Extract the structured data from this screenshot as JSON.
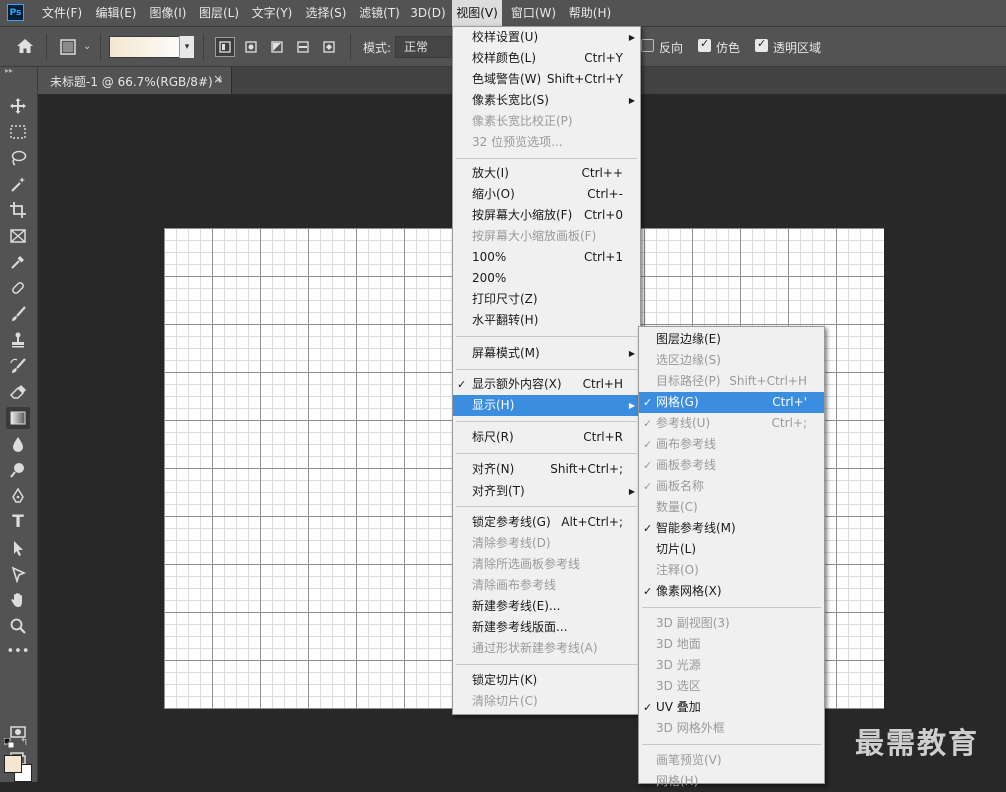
{
  "app": {
    "logo_text": "Ps"
  },
  "menubar": {
    "items": [
      {
        "label": "文件(F)"
      },
      {
        "label": "编辑(E)"
      },
      {
        "label": "图像(I)"
      },
      {
        "label": "图层(L)"
      },
      {
        "label": "文字(Y)"
      },
      {
        "label": "选择(S)"
      },
      {
        "label": "滤镜(T)"
      },
      {
        "label": "3D(D)"
      },
      {
        "label": "视图(V)"
      },
      {
        "label": "窗口(W)"
      },
      {
        "label": "帮助(H)"
      }
    ],
    "active_item": "视图(V)"
  },
  "options_bar": {
    "mode_label": "模式:",
    "mode_value": "正常",
    "checkboxes": [
      {
        "label": "反向",
        "checked": false
      },
      {
        "label": "仿色",
        "checked": true
      },
      {
        "label": "透明区域",
        "checked": true
      }
    ],
    "gradient_colors": [
      "#f3e7d1",
      "#ffffff"
    ]
  },
  "document_tab": {
    "title": "未标题-1 @ 66.7%(RGB/8#) *",
    "close": "×"
  },
  "toolbar": {
    "tools": [
      "move-tool",
      "marquee-tool",
      "lasso-tool",
      "magic-wand-tool",
      "crop-tool",
      "frame-tool",
      "eyedropper-tool",
      "healing-brush-tool",
      "brush-tool",
      "clone-stamp-tool",
      "history-brush-tool",
      "eraser-tool",
      "gradient-tool",
      "blur-tool",
      "dodge-tool",
      "pen-tool",
      "type-tool",
      "path-selection-tool",
      "shape-tool",
      "hand-tool",
      "zoom-tool",
      "more-tools"
    ],
    "selected_tool": "gradient-tool",
    "foreground_color": "#f3e7d1",
    "background_color": "#ffffff"
  },
  "view_menu": {
    "items": [
      {
        "label": "校样设置(U)",
        "shortcut": "",
        "submenu": true,
        "disabled": false
      },
      {
        "label": "校样颜色(L)",
        "shortcut": "Ctrl+Y",
        "disabled": false
      },
      {
        "label": "色域警告(W)",
        "shortcut": "Shift+Ctrl+Y",
        "disabled": false
      },
      {
        "label": "像素长宽比(S)",
        "shortcut": "",
        "submenu": true,
        "disabled": false
      },
      {
        "label": "像素长宽比校正(P)",
        "shortcut": "",
        "disabled": true
      },
      {
        "label": "32 位预览选项...",
        "shortcut": "",
        "disabled": true
      },
      {
        "label": "放大(I)",
        "shortcut": "Ctrl++",
        "disabled": false
      },
      {
        "label": "缩小(O)",
        "shortcut": "Ctrl+-",
        "disabled": false
      },
      {
        "label": "按屏幕大小缩放(F)",
        "shortcut": "Ctrl+0",
        "disabled": false
      },
      {
        "label": "按屏幕大小缩放画板(F)",
        "shortcut": "",
        "disabled": true
      },
      {
        "label": "100%",
        "shortcut": "Ctrl+1",
        "disabled": false
      },
      {
        "label": "200%",
        "shortcut": "",
        "disabled": false
      },
      {
        "label": "打印尺寸(Z)",
        "shortcut": "",
        "disabled": false
      },
      {
        "label": "水平翻转(H)",
        "shortcut": "",
        "disabled": false
      },
      {
        "label": "屏幕模式(M)",
        "shortcut": "",
        "submenu": true,
        "disabled": false
      },
      {
        "label": "显示额外内容(X)",
        "shortcut": "Ctrl+H",
        "checked": true,
        "disabled": false
      },
      {
        "label": "显示(H)",
        "shortcut": "",
        "submenu": true,
        "highlighted": true,
        "disabled": false
      },
      {
        "label": "标尺(R)",
        "shortcut": "Ctrl+R",
        "disabled": false
      },
      {
        "label": "对齐(N)",
        "shortcut": "Shift+Ctrl+;",
        "disabled": false
      },
      {
        "label": "对齐到(T)",
        "shortcut": "",
        "submenu": true,
        "disabled": false
      },
      {
        "label": "锁定参考线(G)",
        "shortcut": "Alt+Ctrl+;",
        "disabled": false
      },
      {
        "label": "清除参考线(D)",
        "shortcut": "",
        "disabled": true
      },
      {
        "label": "清除所选画板参考线",
        "shortcut": "",
        "disabled": true
      },
      {
        "label": "清除画布参考线",
        "shortcut": "",
        "disabled": true
      },
      {
        "label": "新建参考线(E)...",
        "shortcut": "",
        "disabled": false
      },
      {
        "label": "新建参考线版面...",
        "shortcut": "",
        "disabled": false
      },
      {
        "label": "通过形状新建参考线(A)",
        "shortcut": "",
        "disabled": true
      },
      {
        "label": "锁定切片(K)",
        "shortcut": "",
        "disabled": false
      },
      {
        "label": "清除切片(C)",
        "shortcut": "",
        "disabled": true
      }
    ]
  },
  "display_submenu": {
    "items": [
      {
        "label": "图层边缘(E)",
        "shortcut": "",
        "disabled": false
      },
      {
        "label": "选区边缘(S)",
        "shortcut": "",
        "disabled": true
      },
      {
        "label": "目标路径(P)",
        "shortcut": "Shift+Ctrl+H",
        "disabled": true
      },
      {
        "label": "网格(G)",
        "shortcut": "Ctrl+'",
        "checked": true,
        "highlighted": true,
        "disabled": false
      },
      {
        "label": "参考线(U)",
        "shortcut": "Ctrl+;",
        "checked": true,
        "disabled": true
      },
      {
        "label": "画布参考线",
        "shortcut": "",
        "checked": true,
        "disabled": true
      },
      {
        "label": "画板参考线",
        "shortcut": "",
        "checked": true,
        "disabled": true
      },
      {
        "label": "画板名称",
        "shortcut": "",
        "checked": true,
        "disabled": true
      },
      {
        "label": "数量(C)",
        "shortcut": "",
        "disabled": true
      },
      {
        "label": "智能参考线(M)",
        "shortcut": "",
        "checked": true,
        "disabled": false
      },
      {
        "label": "切片(L)",
        "shortcut": "",
        "disabled": false
      },
      {
        "label": "注释(O)",
        "shortcut": "",
        "disabled": true
      },
      {
        "label": "像素网格(X)",
        "shortcut": "",
        "checked": true,
        "disabled": false
      },
      {
        "label": "3D 副视图(3)",
        "shortcut": "",
        "disabled": true
      },
      {
        "label": "3D 地面",
        "shortcut": "",
        "disabled": true
      },
      {
        "label": "3D 光源",
        "shortcut": "",
        "disabled": true
      },
      {
        "label": "3D 选区",
        "shortcut": "",
        "disabled": true
      },
      {
        "label": "UV 叠加",
        "shortcut": "",
        "checked": true,
        "disabled": false
      },
      {
        "label": "3D 网格外框",
        "shortcut": "",
        "disabled": true
      },
      {
        "label": "画笔预览(V)",
        "shortcut": "",
        "disabled": true
      },
      {
        "label": "网格(H)",
        "shortcut": "",
        "disabled": true
      }
    ]
  },
  "watermark": {
    "text": "最需教育"
  }
}
